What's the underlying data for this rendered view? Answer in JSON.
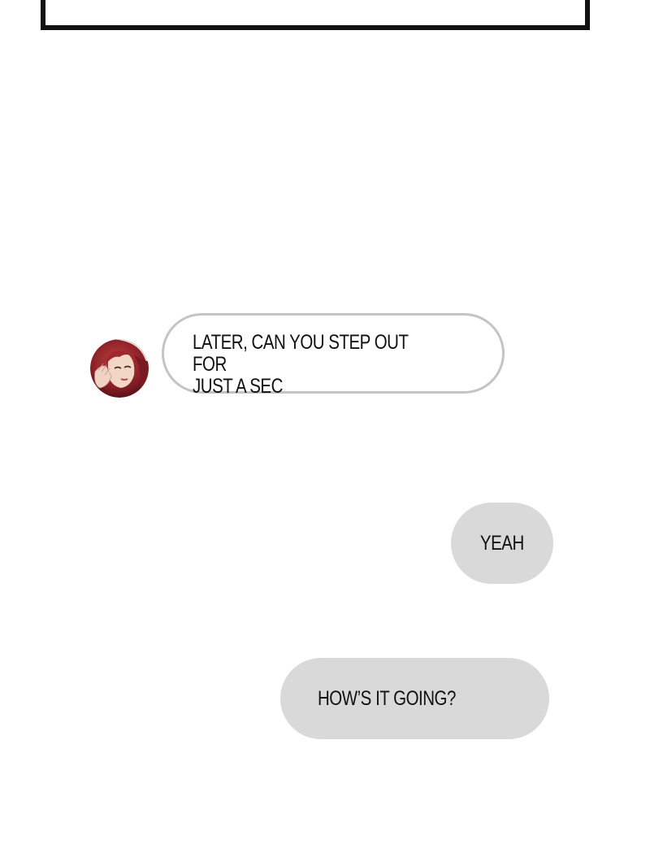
{
  "conversation": {
    "messages": [
      {
        "sender": "contact",
        "text": "LATER, CAN YOU STEP OUT FOR\nJUST A SEC"
      },
      {
        "sender": "me",
        "text": "YEAH"
      },
      {
        "sender": "me",
        "text": "HOW’S IT GOING?"
      }
    ]
  },
  "colors": {
    "incoming_border": "#c4c4c4",
    "outgoing_fill": "#d9d9d9",
    "text": "#111111",
    "frame": "#111111"
  },
  "icons": {
    "contact_avatar": "avatar-red-haired-woman"
  }
}
